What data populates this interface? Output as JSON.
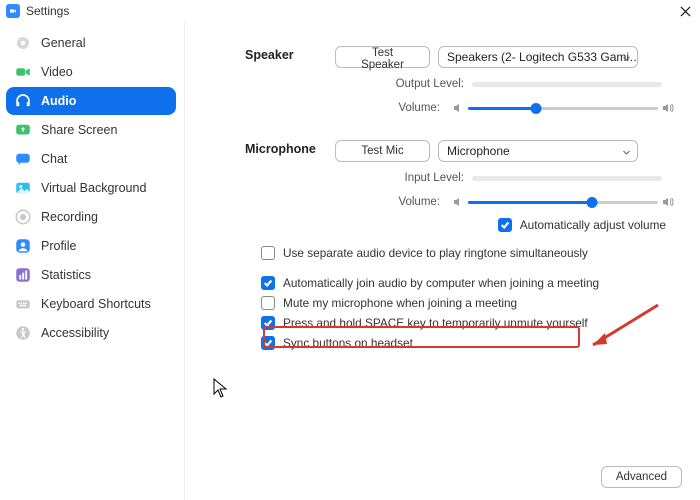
{
  "window": {
    "title": "Settings"
  },
  "sidebar": {
    "items": [
      {
        "label": "General"
      },
      {
        "label": "Video"
      },
      {
        "label": "Audio"
      },
      {
        "label": "Share Screen"
      },
      {
        "label": "Chat"
      },
      {
        "label": "Virtual Background"
      },
      {
        "label": "Recording"
      },
      {
        "label": "Profile"
      },
      {
        "label": "Statistics"
      },
      {
        "label": "Keyboard Shortcuts"
      },
      {
        "label": "Accessibility"
      }
    ]
  },
  "speaker": {
    "heading": "Speaker",
    "test_btn": "Test Speaker",
    "device": "Speakers (2- Logitech G533 Gami…",
    "output_label": "Output Level:",
    "volume_label": "Volume:",
    "volume_pct": 36
  },
  "mic": {
    "heading": "Microphone",
    "test_btn": "Test Mic",
    "device": "Microphone",
    "input_label": "Input Level:",
    "volume_label": "Volume:",
    "volume_pct": 65,
    "auto_adjust": "Automatically adjust volume"
  },
  "options": {
    "separate": "Use separate audio device to play ringtone simultaneously",
    "auto_join": "Automatically join audio by computer when joining a meeting",
    "mute": "Mute my microphone when joining a meeting",
    "space": "Press and hold SPACE key to temporarily unmute yourself",
    "sync": "Sync buttons on headset"
  },
  "advanced_btn": "Advanced"
}
